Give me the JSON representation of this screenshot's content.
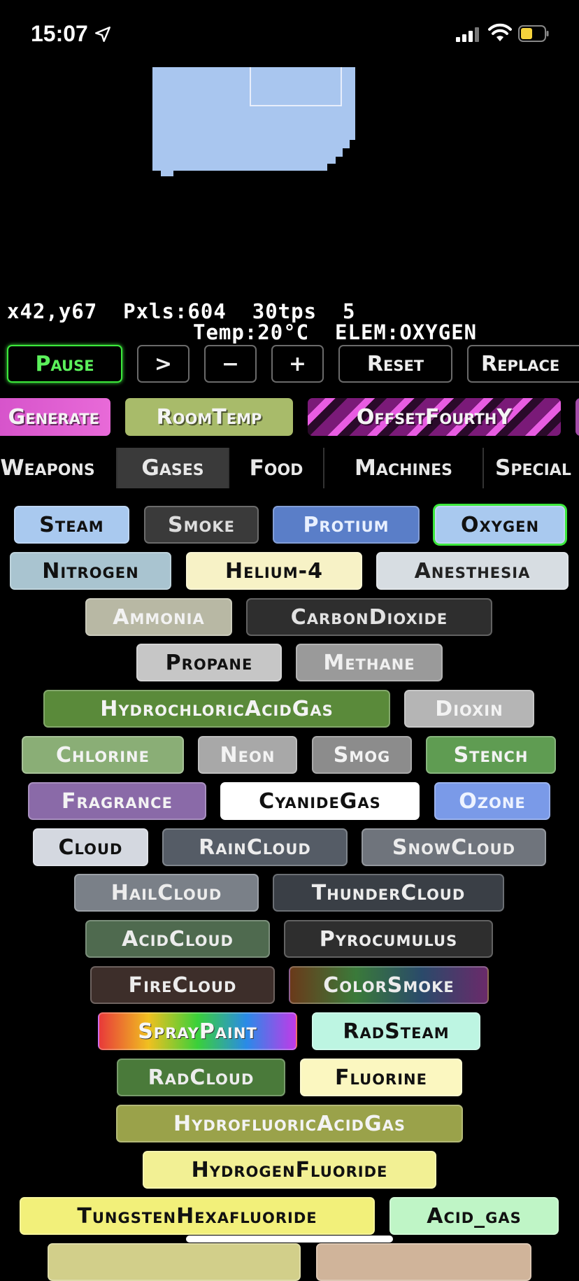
{
  "status": {
    "time": "15:07"
  },
  "stats": {
    "line1": "x42,y67  Pxls:604  30tps  5",
    "line2": "Temp:20°C  ELEM:OXYGEN"
  },
  "controls": {
    "pause": "Pause",
    "step": ">",
    "minus": "−",
    "plus": "+",
    "reset": "Reset",
    "replace": "Replace"
  },
  "tools": {
    "generate": "Generate",
    "roomtemp": "RoomTemp",
    "offset": "OffsetFourthY"
  },
  "categories": [
    "Weapons",
    "Gases",
    "Food",
    "Machines",
    "Special"
  ],
  "elements": [
    "Steam",
    "Smoke",
    "Protium",
    "Oxygen",
    "Nitrogen",
    "Helium-4",
    "Anesthesia",
    "Ammonia",
    "CarbonDioxide",
    "Propane",
    "Methane",
    "HydrochloricAcidGas",
    "Dioxin",
    "Chlorine",
    "Neon",
    "Smog",
    "Stench",
    "Fragrance",
    "CyanideGas",
    "Ozone",
    "Cloud",
    "RainCloud",
    "SnowCloud",
    "HailCloud",
    "ThunderCloud",
    "AcidCloud",
    "Pyrocumulus",
    "FireCloud",
    "ColorSmoke",
    "SprayPaint",
    "RadSteam",
    "RadCloud",
    "Fluorine",
    "HydrofluoricAcidGas",
    "HydrogenFluoride",
    "TungstenHexafluoride",
    "Acid_gas"
  ],
  "colors": {
    "pause_accent": "#3ce83c",
    "selected_outline": "#3ce83c",
    "oxygen": "#a9c6ef"
  },
  "icons": [
    "location-arrow-icon",
    "signal-icon",
    "wifi-icon",
    "battery-icon"
  ]
}
